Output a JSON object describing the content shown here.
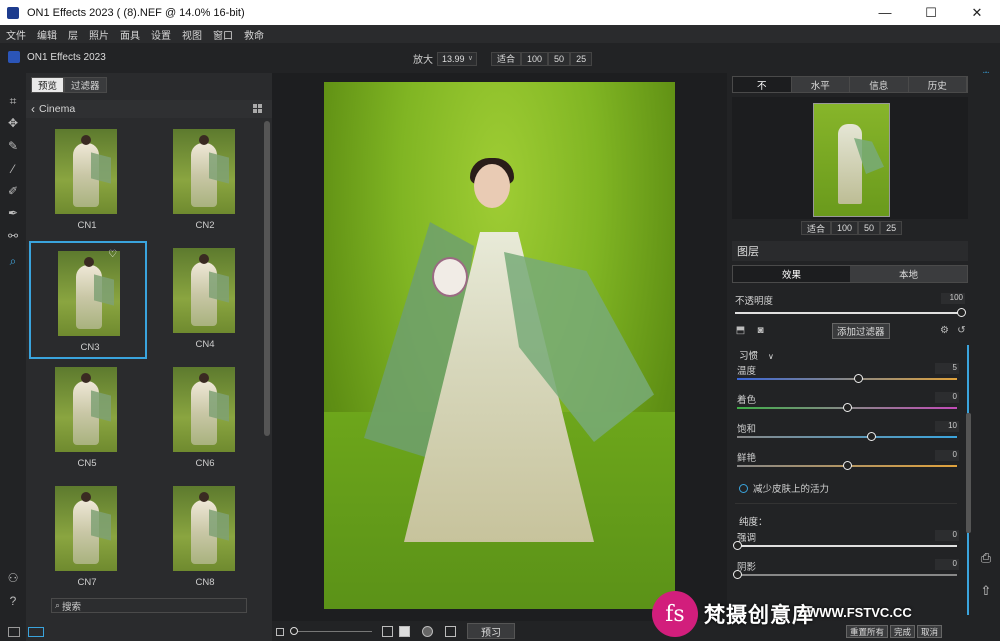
{
  "window": {
    "title": "ON1 Effects 2023 ( (8).NEF @ 14.0% 16-bit)",
    "min_icon": "—",
    "max_icon": "☐",
    "close_icon": "✕"
  },
  "menu": [
    "文件",
    "编辑",
    "层",
    "照片",
    "面具",
    "设置",
    "视图",
    "窗口",
    "救命"
  ],
  "brand": "ON1 Effects 2023",
  "zoom": {
    "label": "放大",
    "value": "13.99",
    "fit": "适合",
    "p100": "100",
    "p50": "50",
    "p25": "25"
  },
  "browser": {
    "tab_preview": "预览",
    "tab_filters": "过滤器",
    "breadcrumb": "Cinema",
    "thumbnails": [
      "CN1",
      "CN2",
      "CN3",
      "CN4",
      "CN5",
      "CN6",
      "CN7",
      "CN8"
    ],
    "selected": "CN3",
    "search_placeholder": "搜索"
  },
  "canvas": {
    "preview_button": "预习"
  },
  "right": {
    "tabs": [
      "不",
      "水平",
      "信息",
      "历史"
    ],
    "nav_buttons": [
      "适合",
      "100",
      "50",
      "25"
    ],
    "layers_title": "图层",
    "layer_tabs": [
      "效果",
      "本地"
    ],
    "opacity_label": "不透明度",
    "opacity_value": "100",
    "opacity_level": 1.0,
    "add_filter": "添加过滤器",
    "section": "习惯",
    "sliders": [
      {
        "label": "温度",
        "value": "5",
        "pos": 0.55
      },
      {
        "label": "着色",
        "value": "0",
        "pos": 0.5
      },
      {
        "label": "饱和",
        "value": "10",
        "pos": 0.61
      },
      {
        "label": "鲜艳",
        "value": "0",
        "pos": 0.5
      }
    ],
    "radio_label": "减少皮肤上的活力",
    "sub_title": "纯度：",
    "sub_sliders": [
      {
        "label": "强调",
        "value": "0",
        "pos": 0
      },
      {
        "label": "阴影",
        "value": "0",
        "pos": 0
      }
    ]
  },
  "bottom_right_buttons": [
    "重置所有",
    "完成",
    "取消"
  ],
  "watermark": {
    "cn": "梵摄创意库",
    "url": "WWW.FSTVC.CC",
    "logo": "fs"
  }
}
